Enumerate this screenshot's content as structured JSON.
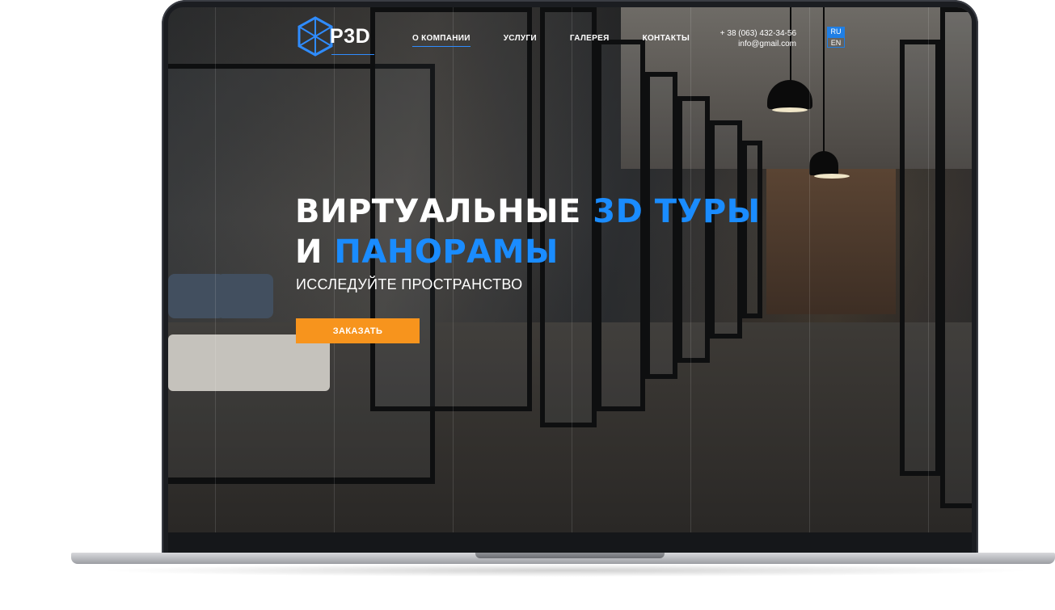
{
  "logo": {
    "text": "P3D",
    "icon": "cube-icon"
  },
  "nav": {
    "items": [
      {
        "label": "О КОМПАНИИ",
        "active": true
      },
      {
        "label": "УСЛУГИ",
        "active": false
      },
      {
        "label": "ГАЛЕРЕЯ",
        "active": false
      },
      {
        "label": "КОНТАКТЫ",
        "active": false
      }
    ]
  },
  "contacts": {
    "phone": "+ 38 (063) 432-34-56",
    "email": "info@gmail.com"
  },
  "lang": {
    "options": [
      "RU",
      "EN"
    ],
    "selected": "RU"
  },
  "hero": {
    "line1_white": "ВИРТУАЛЬНЫЕ ",
    "line1_accent": "3D ТУРЫ",
    "line2_white": "И ",
    "line2_accent": "ПАНОРАМЫ",
    "subtitle": "ИССЛЕДУЙТЕ ПРОСТРАНСТВО",
    "cta_label": "ЗАКАЗАТЬ"
  },
  "colors": {
    "accent": "#1a8cff",
    "cta": "#f7941d",
    "frame": "#1b1d21"
  }
}
